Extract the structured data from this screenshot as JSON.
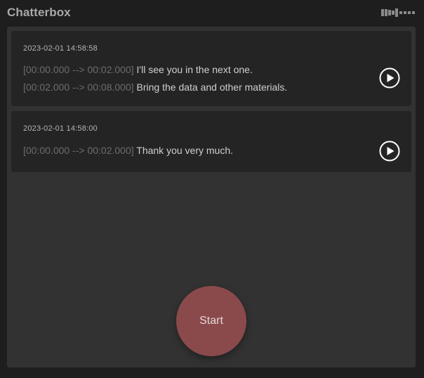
{
  "app": {
    "title": "Chatterbox"
  },
  "transcripts": [
    {
      "timestamp": "2023-02-01 14:58:58",
      "lines": [
        {
          "time": "[00:00.000 --> 00:02.000]",
          "text": "I'll see you in the next one."
        },
        {
          "time": "[00:02.000 --> 00:08.000]",
          "text": "Bring the data and other materials."
        }
      ]
    },
    {
      "timestamp": "2023-02-01 14:58:00",
      "lines": [
        {
          "time": "[00:00.000 --> 00:02.000]",
          "text": "Thank you very much."
        }
      ]
    }
  ],
  "controls": {
    "start_label": "Start"
  },
  "icons": {
    "level": "audio-level-icon",
    "play": "play-icon"
  },
  "colors": {
    "background": "#1e1e1e",
    "panel": "#323232",
    "card": "#242424",
    "start_button": "#8a4a4c",
    "timecode": "#6c6c6c"
  }
}
